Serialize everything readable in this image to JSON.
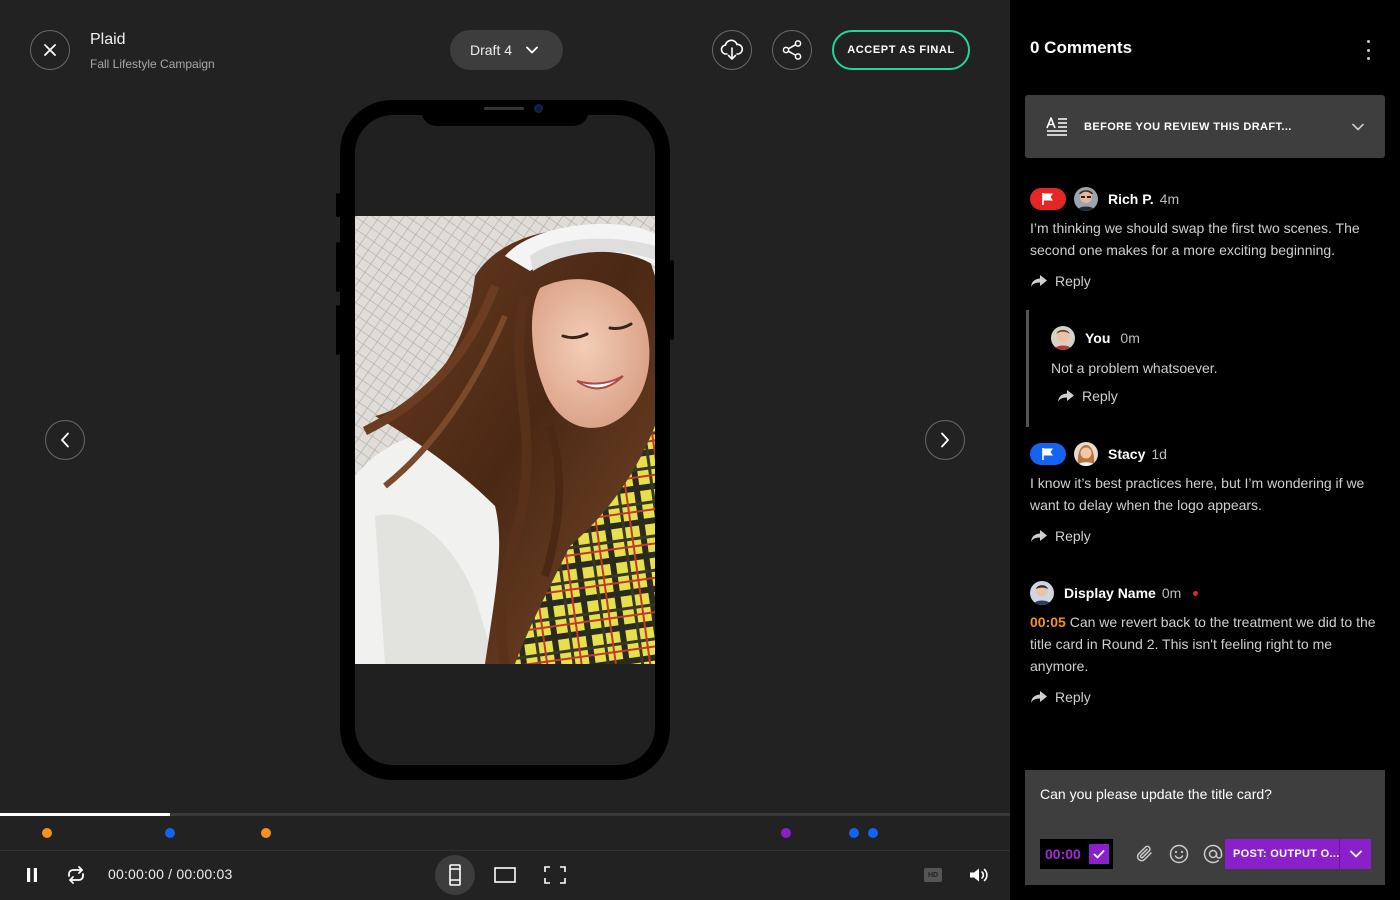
{
  "header": {
    "project_title": "Plaid",
    "project_subtitle": "Fall Lifestyle Campaign",
    "draft_label": "Draft 4",
    "accept_label": "ACCEPT AS FINAL"
  },
  "player": {
    "timecode": "00:00:00 / 00:00:03",
    "progress": 0.168,
    "hd_label": "HD",
    "markers": [
      {
        "pos": 0.047,
        "color": "#f6921e"
      },
      {
        "pos": 0.168,
        "color": "#1463f3"
      },
      {
        "pos": 0.263,
        "color": "#f6921e"
      },
      {
        "pos": 0.778,
        "color": "#8a20c9"
      },
      {
        "pos": 0.846,
        "color": "#1463f3"
      },
      {
        "pos": 0.864,
        "color": "#1463f3"
      }
    ]
  },
  "panel": {
    "title": "0 Comments",
    "before_review": "BEFORE YOU REVIEW THIS DRAFT..."
  },
  "comments": [
    {
      "name": "Rich P.",
      "time": "4m",
      "flag_color": "#e52626",
      "body": "I’m thinking we should swap the first two scenes. The second one makes for a more exciting beginning.",
      "reply": "Reply"
    },
    {
      "name": "You",
      "time": "0m",
      "body": "Not a problem whatsoever.",
      "reply": "Reply"
    },
    {
      "name": "Stacy",
      "time": "1d",
      "flag_color": "#1463f3",
      "body": "I know it’s best practices here, but I’m wondering if we want to delay when the logo appears.",
      "reply": "Reply"
    },
    {
      "name": "Display Name",
      "time": "0m",
      "timestamp": "00:05",
      "body": "Can we revert back to the treatment we did to the title card in Round 2. This isn't feeling right to me anymore.",
      "reply": "Reply"
    }
  ],
  "composer": {
    "input_value": "Can you please update the title card?",
    "time_value": "00:00",
    "post_label": "POST: OUTPUT O..."
  },
  "colors": {
    "accent_green": "#1fd69e",
    "accent_purple": "#8a20c9",
    "timestamp_orange": "#f6921e"
  }
}
